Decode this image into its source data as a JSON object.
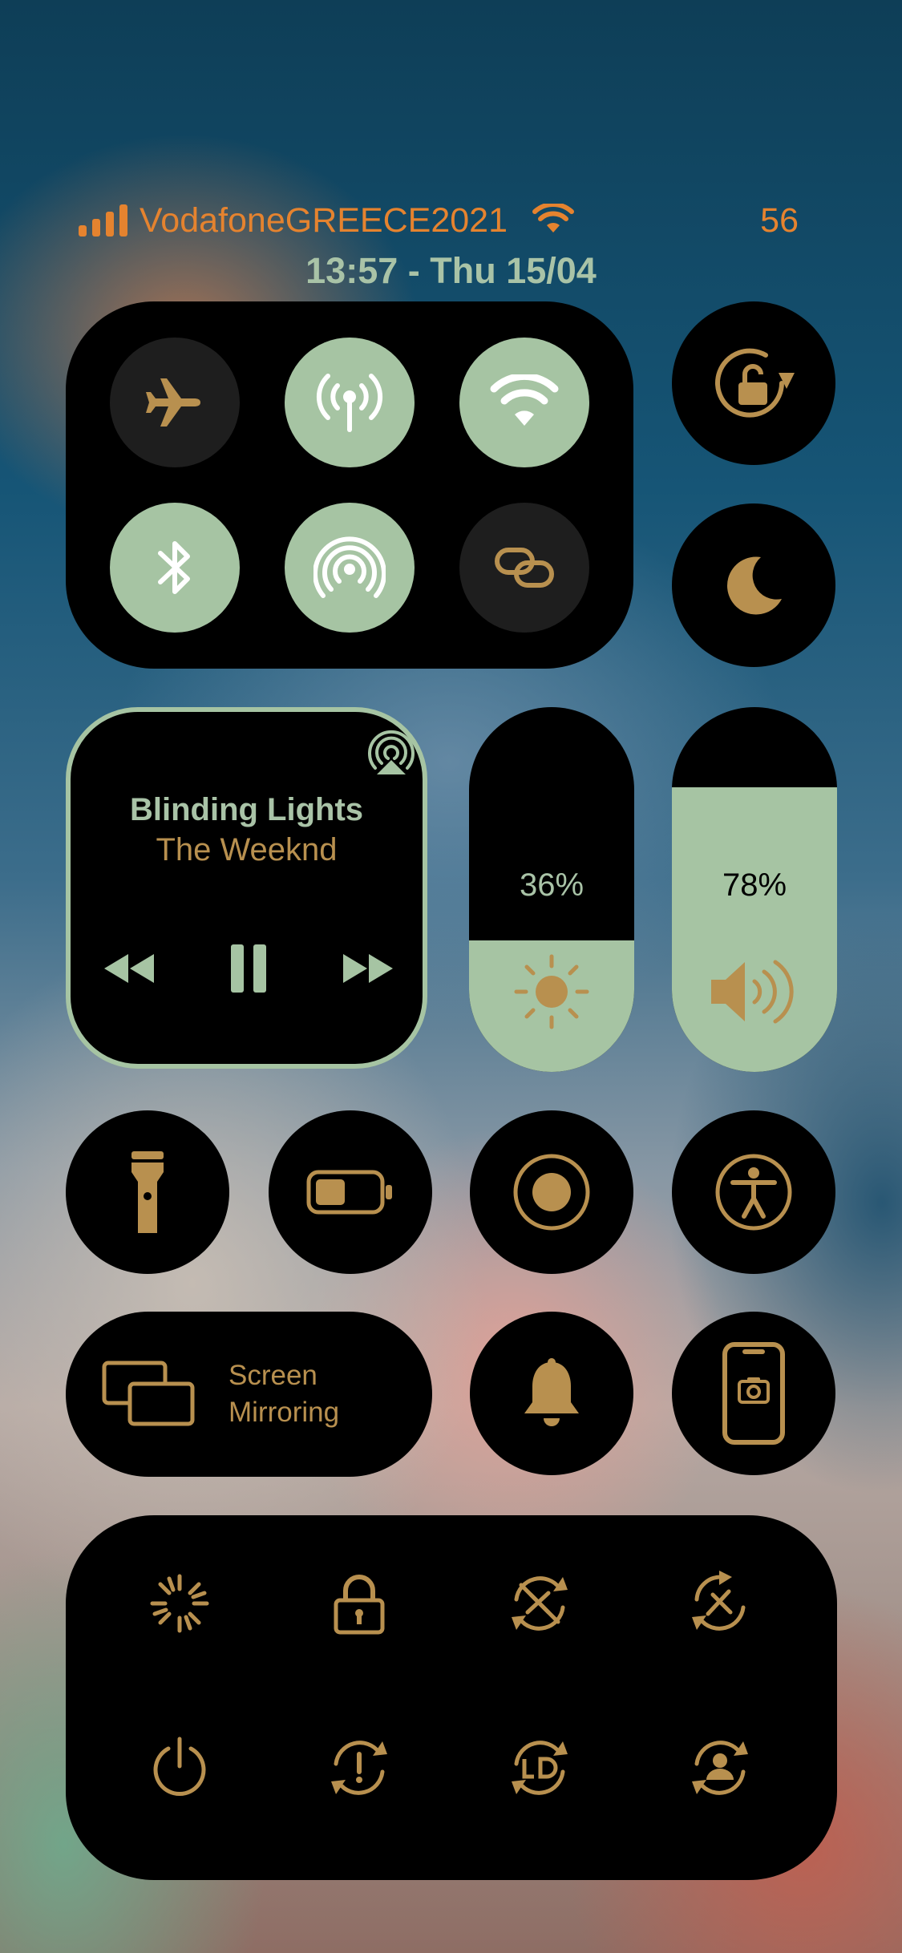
{
  "status_bar": {
    "carrier": "VodafoneGREECE2021",
    "battery": "56",
    "datetime": "13:57 - Thu 15/04",
    "signal_icon": "signal-bars-icon",
    "wifi_icon": "wifi-icon"
  },
  "connectivity": {
    "toggles": [
      {
        "name": "airplane-mode",
        "icon": "airplane-icon",
        "state": "off"
      },
      {
        "name": "cellular-data",
        "icon": "antenna-icon",
        "state": "on"
      },
      {
        "name": "wifi",
        "icon": "wifi-icon",
        "state": "on"
      },
      {
        "name": "bluetooth",
        "icon": "bluetooth-icon",
        "state": "on"
      },
      {
        "name": "airdrop",
        "icon": "airdrop-icon",
        "state": "on"
      },
      {
        "name": "personal-hotspot",
        "icon": "link-icon",
        "state": "off"
      }
    ]
  },
  "orientation_lock": {
    "icon": "rotation-lock-icon"
  },
  "do_not_disturb": {
    "icon": "moon-icon"
  },
  "now_playing": {
    "title": "Blinding Lights",
    "artist": "The Weeknd",
    "airplay_icon": "airplay-audio-icon",
    "controls": [
      "rewind-icon",
      "pause-icon",
      "fast-forward-icon"
    ]
  },
  "brightness": {
    "label": "36%",
    "level": 0.36,
    "icon": "sun-icon"
  },
  "volume": {
    "label": "78%",
    "level": 0.78,
    "icon": "speaker-icon"
  },
  "row_controls": [
    {
      "name": "flashlight",
      "icon": "flashlight-icon"
    },
    {
      "name": "low-power-mode",
      "icon": "battery-icon"
    },
    {
      "name": "screen-recording",
      "icon": "record-icon"
    },
    {
      "name": "accessibility",
      "icon": "accessibility-icon"
    }
  ],
  "screen_mirroring": {
    "line1": "Screen",
    "line2": "Mirroring",
    "icon": "screen-mirroring-icon"
  },
  "bell": {
    "icon": "bell-icon"
  },
  "screenshot": {
    "icon": "phone-camera-icon"
  },
  "bottom_grid": [
    {
      "name": "respring",
      "icon": "spinner-icon"
    },
    {
      "name": "lock",
      "icon": "padlock-icon"
    },
    {
      "name": "safe-mode",
      "icon": "no-tools-refresh-icon"
    },
    {
      "name": "uicache",
      "icon": "tools-refresh-icon"
    },
    {
      "name": "power-off",
      "icon": "power-icon"
    },
    {
      "name": "reboot",
      "icon": "alert-refresh-icon"
    },
    {
      "name": "ldrestart",
      "icon": "ld-refresh-icon"
    },
    {
      "name": "user-space-reboot",
      "icon": "user-refresh-icon"
    }
  ],
  "colors": {
    "accent_gold": "#b8904f",
    "accent_green": "#a6c4a3",
    "status_orange": "#e5832f",
    "tile_black": "#000000"
  }
}
